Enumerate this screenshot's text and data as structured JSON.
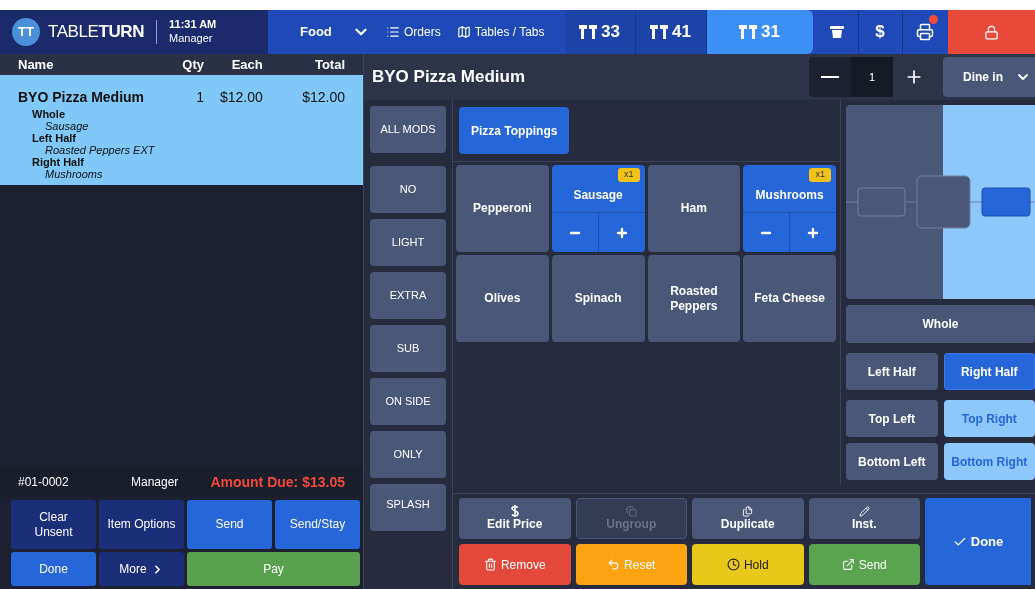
{
  "top_bar": {
    "logo_mark": "TT",
    "logo_text": "TABLE**TURN**",
    "time": "11:31 AM",
    "user": "Manager",
    "menu": "Food",
    "nav": [
      {
        "kind": "list",
        "label": "Orders"
      },
      {
        "kind": "map",
        "label": "Tables / Tabs"
      }
    ],
    "tabs": [
      {
        "label": "33",
        "selected": false
      },
      {
        "label": "41",
        "selected": false
      },
      {
        "label": "31",
        "selected": true
      }
    ],
    "cash_label": "$",
    "printer_alert": true
  },
  "order": {
    "columns": [
      "Name",
      "Qty",
      "Each",
      "Total"
    ],
    "items": [
      {
        "name": "BYO Pizza Medium",
        "qty": "1",
        "each": "$12.00",
        "total": "$12.00",
        "selected": true,
        "groups": [
          {
            "label": "Whole",
            "mods": [
              "Sausage"
            ]
          },
          {
            "label": "Left Half",
            "mods": [
              "Roasted Peppers EXT"
            ]
          },
          {
            "label": "Right Half",
            "mods": [
              "Mushrooms"
            ]
          }
        ]
      }
    ],
    "number": "#01-0002",
    "server": "Manager",
    "amount_due": "Amount Due: $13.05",
    "buttons": [
      {
        "label": "Clear Unsent",
        "kind": "navy"
      },
      {
        "label": "Item Options",
        "kind": "navy"
      },
      {
        "label": "Send",
        "kind": "blue"
      },
      {
        "label": "Send/Stay",
        "kind": "blue"
      },
      {
        "label": "Done",
        "kind": "blue"
      },
      {
        "label": "More",
        "kind": "navy",
        "chevron": true
      },
      {
        "label": "Pay",
        "kind": "green"
      }
    ]
  },
  "item": {
    "title": "BYO Pizza Medium",
    "quantity": "1",
    "service": "Dine in"
  },
  "modifiers": [
    {
      "label": "ALL MODS"
    },
    {
      "label": "NO"
    },
    {
      "label": "LIGHT"
    },
    {
      "label": "EXTRA"
    },
    {
      "label": "SUB"
    },
    {
      "label": "ON SIDE"
    },
    {
      "label": "ONLY"
    },
    {
      "label": "SPLASH"
    }
  ],
  "groups": [
    {
      "label": "Pizza Toppings",
      "selected": true
    }
  ],
  "toppings": [
    {
      "name": "Pepperoni",
      "selected": false
    },
    {
      "name": "Sausage",
      "selected": true,
      "count": "x1"
    },
    {
      "name": "Ham",
      "selected": false
    },
    {
      "name": "Mushrooms",
      "selected": true,
      "count": "x1"
    },
    {
      "name": "Olives",
      "selected": false
    },
    {
      "name": "Spinach",
      "selected": false
    },
    {
      "name": "Roasted Peppers",
      "selected": false
    },
    {
      "name": "Feta Cheese",
      "selected": false
    }
  ],
  "placement": {
    "whole": {
      "label": "Whole",
      "selected": false,
      "covered": false
    },
    "options": [
      {
        "label": "Left Half",
        "selected": false,
        "covered": false
      },
      {
        "label": "Right Half",
        "selected": true,
        "covered": true
      },
      {
        "label": "Top Left",
        "selected": false,
        "covered": false
      },
      {
        "label": "Top Right",
        "selected": false,
        "covered": true
      },
      {
        "label": "Bottom Left",
        "selected": false,
        "covered": false
      },
      {
        "label": "Bottom Right",
        "selected": false,
        "covered": true
      }
    ]
  },
  "actions": [
    {
      "label": "Edit Price",
      "color": "#4b5778",
      "disabled": false
    },
    {
      "label": "Ungroup",
      "color": "#4b5778",
      "disabled": true
    },
    {
      "label": "Duplicate",
      "color": "#4b5778",
      "disabled": false
    },
    {
      "label": "Inst.",
      "color": "#4b5778",
      "disabled": false
    },
    {
      "label": "Remove",
      "color": "#e4483a",
      "disabled": false
    },
    {
      "label": "Reset",
      "color": "#fca311",
      "disabled": false
    },
    {
      "label": "Hold",
      "color": "#e8c81a",
      "disabled": false
    },
    {
      "label": "Send",
      "color": "#5aa34f",
      "disabled": false
    }
  ],
  "done_label": "Done"
}
